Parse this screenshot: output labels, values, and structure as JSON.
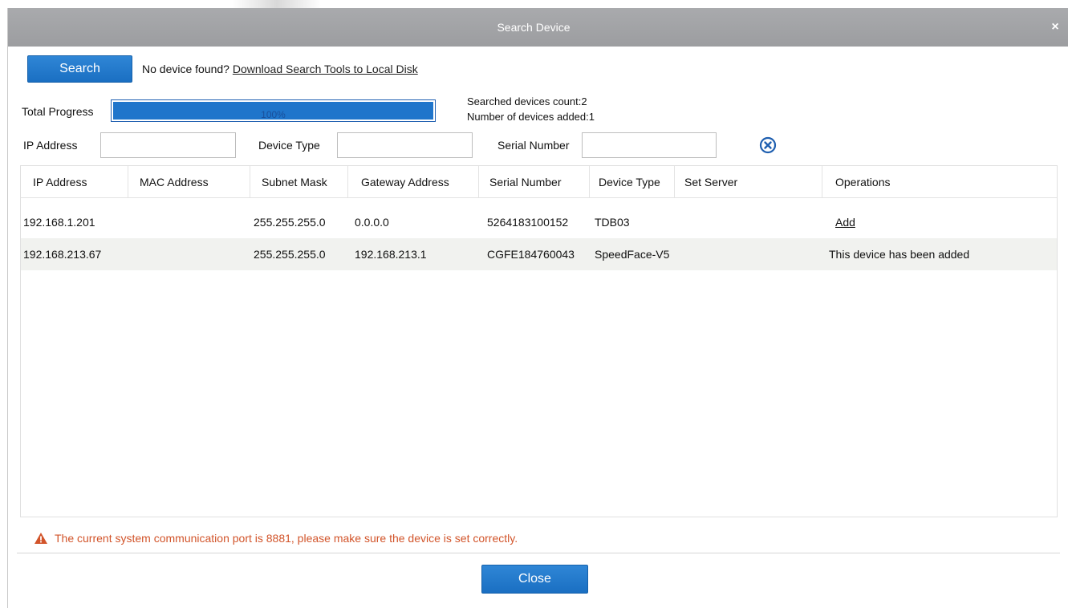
{
  "dialog": {
    "title": "Search Device",
    "close_glyph": "×"
  },
  "toolbar": {
    "search_label": "Search",
    "no_device_text": "No device found?",
    "download_link": "Download Search Tools to Local Disk"
  },
  "progress": {
    "label": "Total Progress",
    "percent_text": "100%",
    "value": 1.0,
    "searched_count": "Searched devices count:2",
    "added_count": "Number of devices added:1"
  },
  "filters": {
    "ip_label": "IP Address",
    "ip_value": "",
    "type_label": "Device Type",
    "type_value": "",
    "serial_label": "Serial Number",
    "serial_value": "",
    "clear_icon": "circle-x-icon"
  },
  "table": {
    "headers": [
      "IP Address",
      "MAC Address",
      "Subnet Mask",
      "Gateway Address",
      "Serial Number",
      "Device Type",
      "Set Server",
      "Operations"
    ],
    "rows": [
      [
        "192.168.1.201",
        "",
        "255.255.255.0",
        "0.0.0.0",
        "5264183100152",
        "TDB03",
        "",
        "Add"
      ],
      [
        "192.168.213.67",
        "",
        "255.255.255.0",
        "192.168.213.1",
        "CGFE184760043",
        "SpeedFace-V5",
        "",
        "This device has been added"
      ]
    ]
  },
  "footer": {
    "warning_icon": "warning-triangle-icon",
    "warning_text": "The current system communication port is 8881, please make sure the device is set correctly.",
    "close_label": "Close"
  },
  "colors": {
    "accent": "#1f75cb",
    "title_bar": "#a3a4a7",
    "warning": "#d2542a",
    "alt_row": "#f1f2ef"
  }
}
